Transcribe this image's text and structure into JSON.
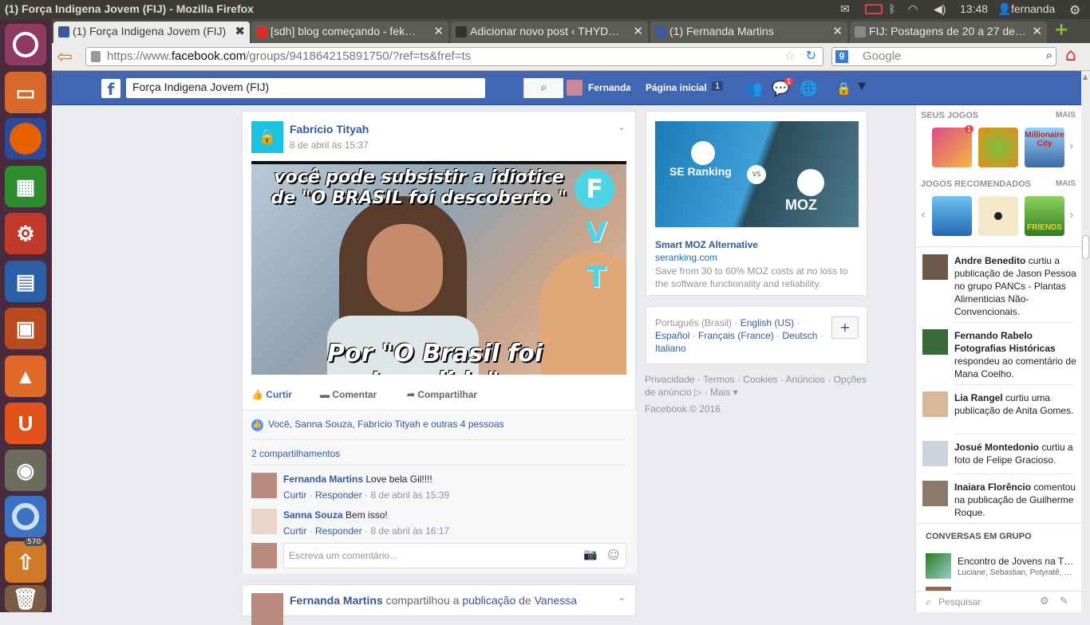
{
  "window": {
    "title": "(1) Força Indigena Jovem (FIJ) - Mozilla Firefox",
    "clock": "13:48",
    "user": "fernanda"
  },
  "launcher": {
    "badge": "570"
  },
  "tabs": [
    {
      "label": "(1) Força Indigena Jovem (FIJ)",
      "active": true
    },
    {
      "label": "[sdh] blog começando - fek…"
    },
    {
      "label": "Adicionar novo post ‹ THYD…"
    },
    {
      "label": "(1) Fernanda Martins"
    },
    {
      "label": "FIJ: Postagens de 20 a 27 de…"
    }
  ],
  "nav": {
    "url_prefix": "https://www.",
    "url_domain": "facebook.com",
    "url_rest": "/groups/941864215891750/?ref=ts&fref=ts",
    "search_placeholder": "Google"
  },
  "fb": {
    "search_value": "Força Indigena Jovem (FIJ)",
    "profile_name": "Fernanda",
    "home_label": "Página inicial",
    "home_count": "1",
    "messages_badge": "1"
  },
  "post": {
    "author": "Fabrício Tityah",
    "date": "8 de abril às 15:37",
    "image_top": "você pode subsistir a idiotice de \"O BRASIL foi descoberto \"",
    "image_bottom": "Por \"O Brasil foi Invadido\"",
    "image_logo": [
      "F",
      "V",
      "T"
    ],
    "actions": {
      "like": "Curtir",
      "comment": "Comentar",
      "share": "Compartilhar"
    },
    "likes_text": "Você, Sanna Souza, Fabrício Tityah e outras 4 pessoas",
    "shares_text": "2 compartilhamentos",
    "comments": [
      {
        "author": "Fernanda Martins",
        "text": "Love bela Gil!!!!",
        "like": "Curtir",
        "reply": "Responder",
        "time": "8 de abril às 15:39"
      },
      {
        "author": "Sanna Souza",
        "text": "Bem isso!",
        "like": "Curtir",
        "reply": "Responder",
        "time": "8 de abril às 16:17"
      }
    ],
    "comment_placeholder": "Escreva um comentário..."
  },
  "post2": {
    "author": "Fernanda Martins",
    "verb": "compartilhou a",
    "object": "publicação",
    "prep": "de",
    "target": "Vanessa"
  },
  "ad": {
    "img_left": "SE Ranking",
    "img_vs": "VS",
    "img_right": "MOZ",
    "title": "Smart MOZ Alternative",
    "domain": "seranking.com",
    "desc": "Save from 30 to 60% MOZ costs at no loss to the software functionality and reliability."
  },
  "languages": {
    "current": "Português (Brasil)",
    "others": [
      "English (US)",
      "Español",
      "Français (France)",
      "Deutsch",
      "Italiano"
    ],
    "add": "+"
  },
  "footer": {
    "links": [
      "Privacidade",
      "Termos",
      "Cookies",
      "Anúncios",
      "Opções de anúncio",
      "Mais"
    ],
    "copyright": "Facebook © 2016"
  },
  "right": {
    "your_games": "SEUS JOGOS",
    "more1": "MAIS",
    "game_badge": "1",
    "game3_label": "Millionaire City",
    "recommended": "JOGOS RECOMENDADOS",
    "more2": "MAIS",
    "game6_label": "FRIENDS",
    "activity": [
      {
        "name": "Andre Benedito",
        "text": "curtiu a publicação de Jason Pessoa no grupo PANCs - Plantas Alimenticias Não-Convencionais."
      },
      {
        "name": "Fernando Rabelo Fotografias Históricas",
        "text": "respondeu ao comentário de Mana Coelho."
      },
      {
        "name": "Lia Rangel",
        "text": "curtiu uma publicação de Anita Gomes."
      },
      {
        "name": "Josué Montedonio",
        "text": "curtiu a foto de Felipe Gracioso."
      },
      {
        "name": "Inaiara Florêncio",
        "text": "comentou na publicação de Guilherme Roque."
      }
    ],
    "group_chats": "CONVERSAS EM GRUPO",
    "chat_title": "Encontro de Jovens na T…",
    "chat_members": "Luciane, Sebastian, Potyratê, …",
    "search": "Pesquisar"
  }
}
